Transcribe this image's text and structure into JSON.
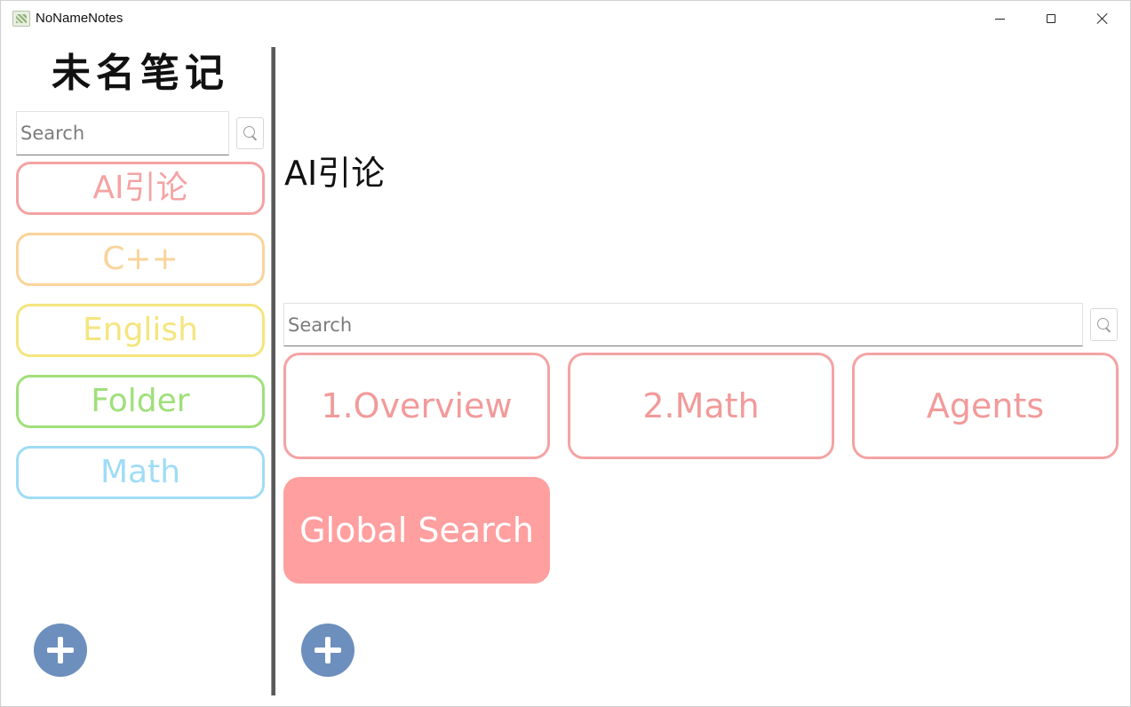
{
  "window": {
    "title": "NoNameNotes"
  },
  "sidebar": {
    "logo": "未名笔记",
    "search_placeholder": "Search",
    "notebooks": [
      {
        "label": "AI引论",
        "color": "#f4a3a3"
      },
      {
        "label": "C++",
        "color": "#fad39a"
      },
      {
        "label": "English",
        "color": "#f4e57e"
      },
      {
        "label": "Folder",
        "color": "#9fe07a"
      },
      {
        "label": "Math",
        "color": "#9fdcf6"
      }
    ]
  },
  "main": {
    "notebook_title": "AI引论",
    "search_placeholder": "Search",
    "notes": [
      {
        "label": "1.Overview"
      },
      {
        "label": "2.Math"
      },
      {
        "label": "Agents"
      },
      {
        "label": "Global Search",
        "filled": true
      }
    ]
  },
  "colors": {
    "note_accent": "#f4a3a3",
    "add_button": "#6d8fbd"
  },
  "icons": {
    "search": "search-icon",
    "add": "plus-icon",
    "minimize": "minimize-icon",
    "maximize": "maximize-icon",
    "close": "close-icon"
  }
}
